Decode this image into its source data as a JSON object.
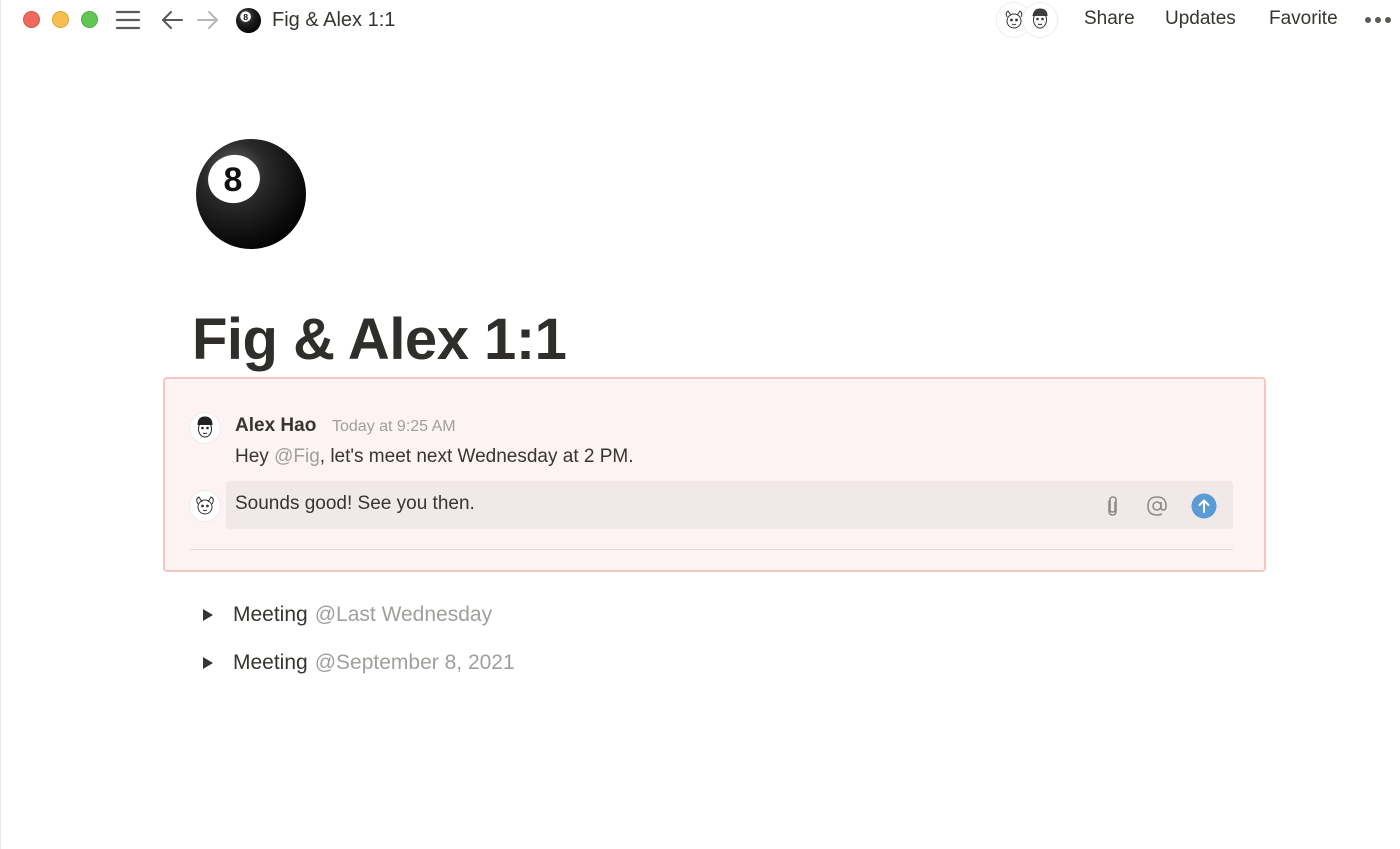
{
  "window": {
    "title": "Fig & Alex 1:1"
  },
  "topbar": {
    "breadcrumb_title": "Fig & Alex 1:1",
    "actions": {
      "share": "Share",
      "updates": "Updates",
      "favorite": "Favorite"
    }
  },
  "page": {
    "icon": "8-ball-icon",
    "title": "Fig & Alex 1:1"
  },
  "comment": {
    "author": "Alex Hao",
    "time": "Today at 9:25 AM",
    "body_prefix": "Hey ",
    "body_mention": "@Fig",
    "body_suffix": ", let's meet next Wednesday at 2 PM.",
    "reply_value": "Sounds good! See you then."
  },
  "toggles": [
    {
      "label": "Meeting",
      "date": "@Last Wednesday"
    },
    {
      "label": "Meeting",
      "date": "@September 8, 2021"
    }
  ],
  "colors": {
    "accent_blue": "#5a9bd5",
    "comment_bg": "#fdf3f2",
    "comment_border": "#f4c7c3",
    "muted_text": "#a09f9b"
  }
}
